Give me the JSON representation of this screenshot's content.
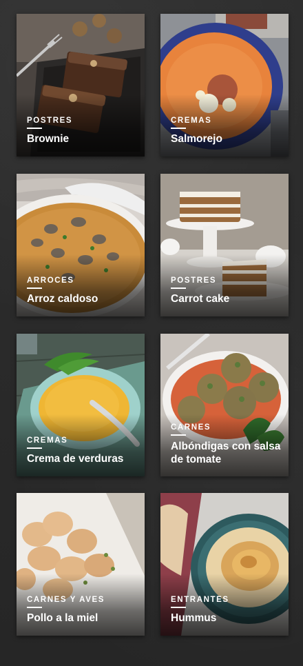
{
  "recipes": [
    {
      "category": "POSTRES",
      "title": "Brownie"
    },
    {
      "category": "CREMAS",
      "title": "Salmorejo"
    },
    {
      "category": "ARROCES",
      "title": "Arroz caldoso"
    },
    {
      "category": "POSTRES",
      "title": "Carrot cake"
    },
    {
      "category": "CREMAS",
      "title": "Crema de verduras"
    },
    {
      "category": "CARNES",
      "title": "Albóndigas con salsa de tomate"
    },
    {
      "category": "CARNES Y AVES",
      "title": "Pollo a la miel"
    },
    {
      "category": "ENTRANTES",
      "title": "Hummus"
    }
  ]
}
